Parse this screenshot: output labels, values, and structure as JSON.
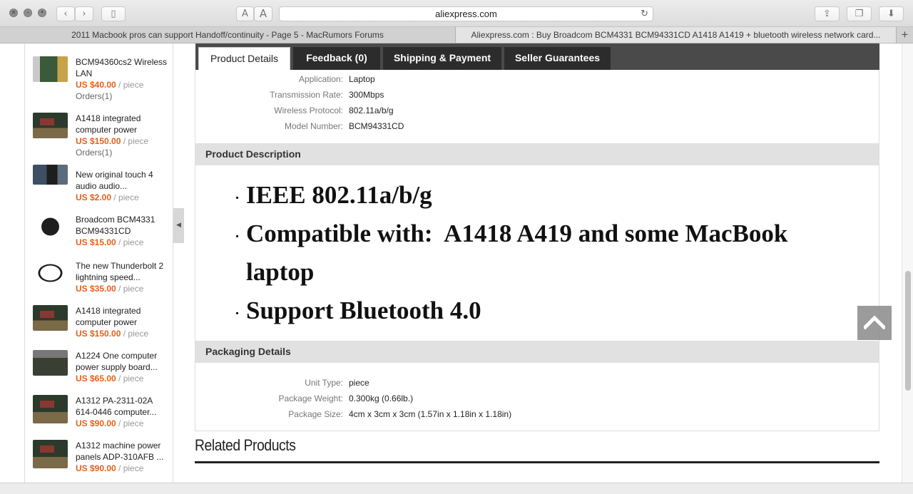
{
  "browser": {
    "url": "aliexpress.com",
    "font_small": "A",
    "font_large": "A",
    "tabs": [
      {
        "label": "2011 Macbook pros can support Handoff/continuity - Page 5 - MacRumors Forums"
      },
      {
        "label": "Aliexpress.com : Buy Broadcom BCM4331 BCM94331CD A1418 A1419 + bluetooth wireless network card..."
      }
    ],
    "new_tab": "+"
  },
  "sidebar": {
    "items": [
      {
        "name": "BCM94360cs2 Wireless LAN",
        "price": "US $40.00",
        "unit": " / piece",
        "orders": "Orders(1)"
      },
      {
        "name": "A1418 integrated computer power",
        "price": "US $150.00",
        "unit": " / piece",
        "orders": "Orders(1)"
      },
      {
        "name": "New original touch 4 audio audio...",
        "price": "US $2.00",
        "unit": " / piece"
      },
      {
        "name": "Broadcom BCM4331 BCM94331CD",
        "price": "US $15.00",
        "unit": " / piece"
      },
      {
        "name": "The new Thunderbolt 2 lightning speed...",
        "price": "US $35.00",
        "unit": " / piece"
      },
      {
        "name": "A1418 integrated computer power",
        "price": "US $150.00",
        "unit": " / piece"
      },
      {
        "name": "A1224 One computer power supply board...",
        "price": "US $65.00",
        "unit": " / piece"
      },
      {
        "name": "A1312 PA-2311-02A 614-0446 computer...",
        "price": "US $90.00",
        "unit": " / piece"
      },
      {
        "name": "A1312 machine power panels ADP-310AFB ...",
        "price": "US $90.00",
        "unit": " / piece"
      }
    ]
  },
  "product_tabs": {
    "details": "Product Details",
    "feedback": "Feedback (0)",
    "shipping": "Shipping & Payment",
    "guarantees": "Seller Guarantees"
  },
  "specs": [
    {
      "k": "Application:",
      "v": "Laptop"
    },
    {
      "k": "Transmission Rate:",
      "v": "300Mbps"
    },
    {
      "k": "Wireless Protocol:",
      "v": "802.11a/b/g"
    },
    {
      "k": "Model Number:",
      "v": "BCM94331CD"
    }
  ],
  "description": {
    "heading": "Product Description",
    "lines": [
      "IEEE 802.11a/b/g",
      "Compatible with:  A1418 A419 and some MacBook",
      "laptop",
      "Support Bluetooth 4.0"
    ],
    "bullet": "."
  },
  "packaging": {
    "heading": "Packaging Details",
    "rows": [
      {
        "k": "Unit Type:",
        "v": "piece"
      },
      {
        "k": "Package Weight:",
        "v": "0.300kg (0.66lb.)"
      },
      {
        "k": "Package Size:",
        "v": "4cm x 3cm x 3cm (1.57in x 1.18in x 1.18in)"
      }
    ]
  },
  "related": {
    "heading": "Related Products"
  },
  "colors": {
    "price": "#e5601a",
    "tabbar": "#4a4a4a"
  }
}
